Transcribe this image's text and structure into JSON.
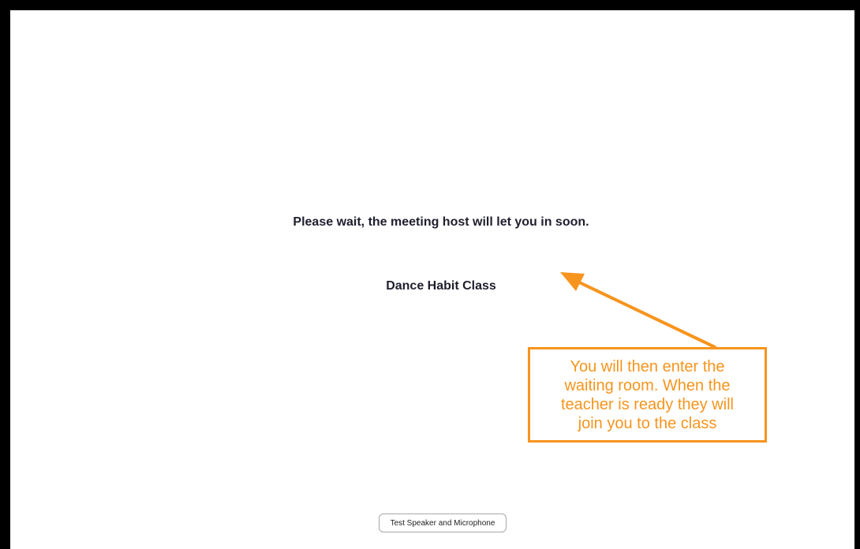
{
  "waiting_room": {
    "message": "Please wait, the meeting host will let you in soon.",
    "meeting_name": "Dance Habit Class",
    "test_button_label": "Test Speaker and Microphone"
  },
  "annotation": {
    "lines": [
      "You will then enter the",
      "waiting room. When the",
      "teacher is ready they will",
      "join you to the class"
    ],
    "color": "#f7941d",
    "icon": "arrow-pointer-icon"
  },
  "colors": {
    "frame": "#000000",
    "text": "#1f1f2e",
    "accent": "#f7941d"
  }
}
